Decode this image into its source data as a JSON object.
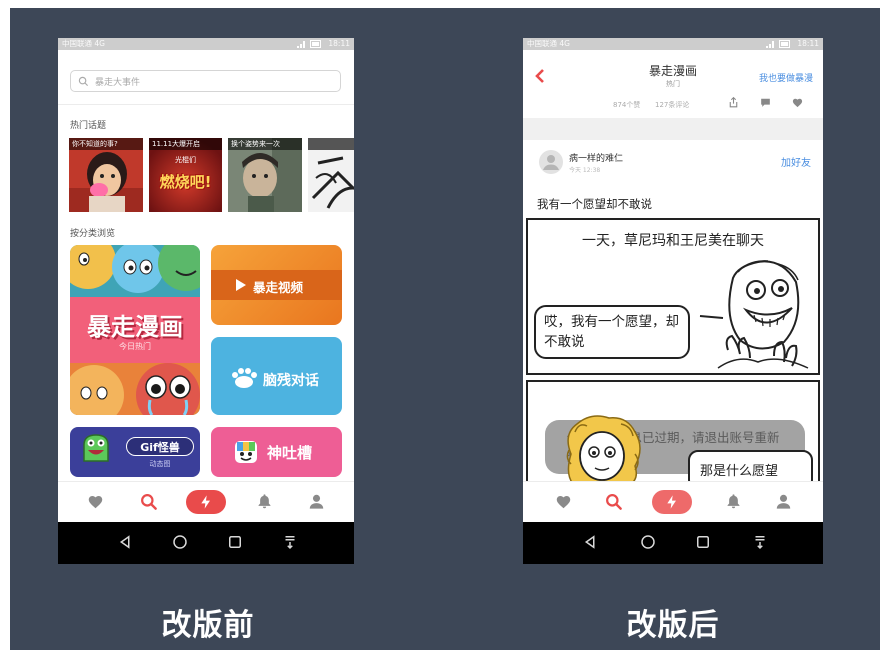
{
  "colors": {
    "slide_background": "#3d4757",
    "caption_text": "#ffffff",
    "accent_red": "#e94b4b",
    "link_blue": "#4a8ee0"
  },
  "captions": {
    "before": "改版前",
    "after": "改版后"
  },
  "tab_bar": {
    "icons": [
      "heart-icon",
      "search-icon",
      "bolt-icon",
      "bell-icon",
      "user-icon"
    ]
  },
  "nav_bar": {
    "icons": [
      "back-icon",
      "home-icon",
      "recents-icon",
      "menu-icon"
    ]
  },
  "before": {
    "status_bar": {
      "carrier": "中国联通 4G",
      "time": "18:11"
    },
    "search": {
      "icon": "search-icon",
      "placeholder": "暴走大事件"
    },
    "hot_topics": {
      "label": "热门话题",
      "items": [
        {
          "caption": "你不知道的事?"
        },
        {
          "caption": "11.11大爆开启",
          "line2": "光棍们",
          "headline": "燃烧吧!"
        },
        {
          "caption": "换个姿势来一次"
        }
      ]
    },
    "categories": {
      "label": "按分类浏览",
      "items": [
        {
          "title": "暴走漫画",
          "subtitle": "今日热门",
          "color": "#f2607a"
        },
        {
          "title": "暴走视频",
          "icon": "play-icon",
          "color": "#f08a2a"
        },
        {
          "title": "脑残对话",
          "icon": "paw-icon",
          "color": "#4db3e0"
        },
        {
          "title": "Gif怪兽",
          "subtitle": "动态图",
          "color": "#3b3f9a"
        },
        {
          "title": "神吐槽",
          "color": "#ee5e95"
        }
      ]
    }
  },
  "after": {
    "status_bar": {
      "carrier": "中国联通 4G",
      "time": "18:11"
    },
    "header": {
      "back_icon": "chevron-left-icon",
      "title": "暴走漫画",
      "subtitle": "热门",
      "action": "我也要做暴漫"
    },
    "stats": {
      "likes": "874个赞",
      "comments": "127条评论"
    },
    "post": {
      "author": "病一样的难仁",
      "time": "今天 12:38",
      "add_friend": "加好友",
      "title": "我有一个愿望却不敢说"
    },
    "comic": {
      "caption": "一天，草尼玛和王尼美在聊天",
      "bubble1": "哎，我有一个愿望，却不敢说",
      "bubble2": "那是什么愿望"
    },
    "toast": "你的登录信息已过期，请退出账号重新登录"
  }
}
